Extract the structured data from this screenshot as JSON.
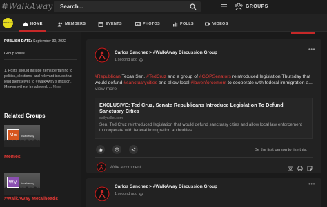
{
  "header": {
    "logo": "#WalkAway",
    "search_placeholder": "Search...",
    "groups_label": "GROUPS"
  },
  "nav": {
    "items": [
      {
        "label": "HOME",
        "icon": "home-icon"
      },
      {
        "label": "MEMBERS",
        "icon": "members-icon"
      },
      {
        "label": "EVENTS",
        "icon": "events-icon"
      },
      {
        "label": "PHOTOS",
        "icon": "photos-icon"
      },
      {
        "label": "POLLS",
        "icon": "polls-icon"
      },
      {
        "label": "VIDEOS",
        "icon": "videos-icon"
      }
    ]
  },
  "sidebar": {
    "publish_label": "PUBLISH DATE:",
    "publish_date": " September 30, 2022",
    "group_rules": "Group Rules",
    "rules_text": "1. Posts should include items pertaining to politics, elections, and relevant issues that lend themselves to #WalkAway's mission. Memes will not be allowed. ...",
    "rules_more": " More",
    "related_groups": "Related Groups",
    "groups": [
      {
        "badge": "ME",
        "tag": "#walkaway",
        "name": "Memes",
        "color": "#d6561e"
      },
      {
        "badge": "WM",
        "tag": "#walkaway",
        "name": "#WalkAway Metalheads",
        "color": "#8a4fb0"
      }
    ]
  },
  "posts": [
    {
      "author": "Carlos Sanchez > #WalkAway Discussion Group",
      "time": "1 second ago",
      "body_parts": [
        {
          "text": "#Republican",
          "tag": true
        },
        {
          "text": " Texas Sen. ",
          "tag": false
        },
        {
          "text": "#TedCruz",
          "tag": true
        },
        {
          "text": " and a group of ",
          "tag": false
        },
        {
          "text": "#GOPSenators",
          "tag": true
        },
        {
          "text": " reintroduced legislation Thursday that would defund ",
          "tag": false
        },
        {
          "text": "#sanctuarycities",
          "tag": true
        },
        {
          "text": " and allow local ",
          "tag": false
        },
        {
          "text": "#lawenforcement",
          "tag": true
        },
        {
          "text": " to cooperate with federal immigration a...",
          "tag": false
        }
      ],
      "view_more": " View more",
      "link_title": "EXCLUSIVE: Ted Cruz, Senate Republicans Introduce Legislation To Defund Sanctuary Cities",
      "link_domain": "dailycaller.com",
      "link_desc": "Sen. Ted Cruz reintroduced legislation that would defund sanctuary cities and allow local law enforcement to cooperate with federal immigration authorities.",
      "first_like": "Be the first person to like this.",
      "comment_placeholder": "Write a comment..."
    },
    {
      "author": "Carlos Sanchez > #WalkAway Discussion Group",
      "time": "1 second ago"
    }
  ]
}
